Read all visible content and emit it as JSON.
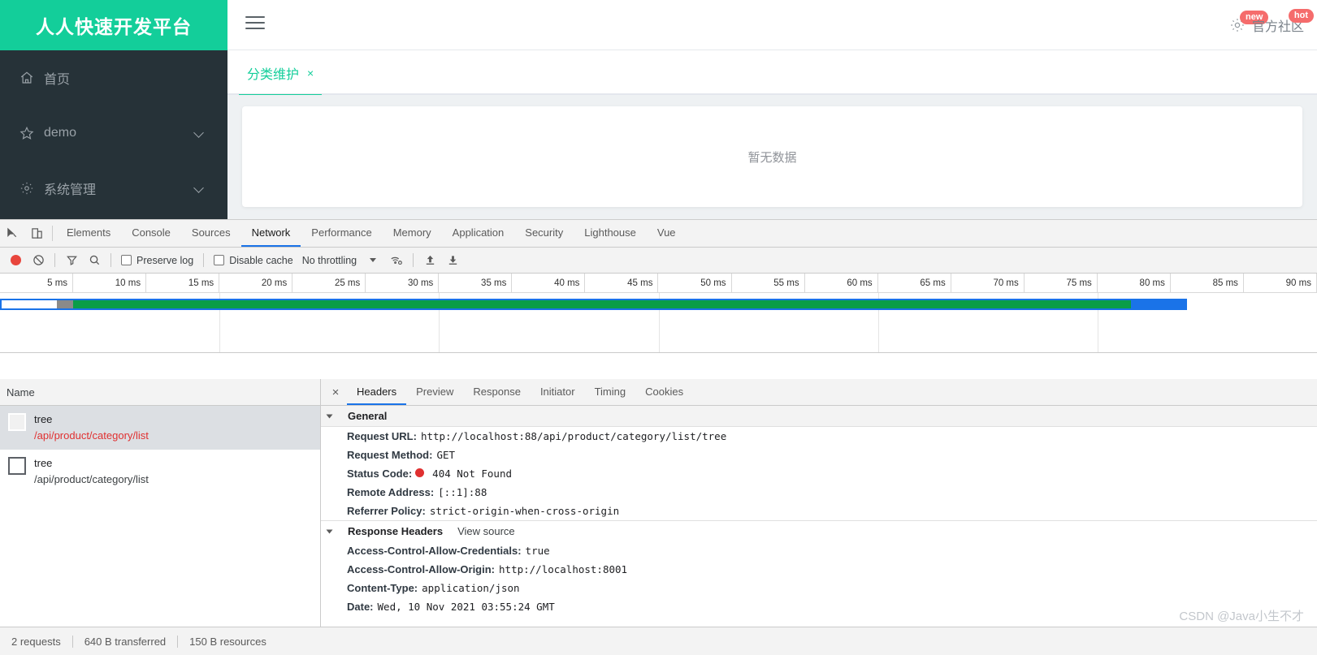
{
  "webapp": {
    "logo": "人人快速开发平台",
    "hamburger_icon": "hamburger-icon",
    "gear_icon": "gear-icon",
    "gear_badge": "new",
    "community_label": "官方社区",
    "community_badge": "hot",
    "sidebar": [
      {
        "label": "首页",
        "icon": "home-icon",
        "expandable": false
      },
      {
        "label": "demo",
        "icon": "star-icon",
        "expandable": true
      },
      {
        "label": "系统管理",
        "icon": "gear-icon",
        "expandable": true
      }
    ],
    "tabs": [
      {
        "label": "分类维护",
        "close": "×",
        "active": true
      }
    ],
    "card": {
      "empty_text": "暂无数据"
    }
  },
  "devtools": {
    "panel_tabs": [
      {
        "label": "Elements",
        "active": false
      },
      {
        "label": "Console",
        "active": false
      },
      {
        "label": "Sources",
        "active": false
      },
      {
        "label": "Network",
        "active": true
      },
      {
        "label": "Performance",
        "active": false
      },
      {
        "label": "Memory",
        "active": false
      },
      {
        "label": "Application",
        "active": false
      },
      {
        "label": "Security",
        "active": false
      },
      {
        "label": "Lighthouse",
        "active": false
      },
      {
        "label": "Vue",
        "active": false
      }
    ],
    "toolbar": {
      "record_icon": "record-icon",
      "clear_icon": "clear-icon",
      "filter_icon": "filter-icon",
      "search_icon": "search-icon",
      "preserve_log": {
        "label": "Preserve log",
        "checked": false
      },
      "disable_cache": {
        "label": "Disable cache",
        "checked": false
      },
      "throttling": "No throttling",
      "wifi_icon": "wifi-settings-icon",
      "import_icon": "upload-har-icon",
      "export_icon": "download-har-icon"
    },
    "timeline": {
      "ticks": [
        "5 ms",
        "10 ms",
        "15 ms",
        "20 ms",
        "25 ms",
        "30 ms",
        "35 ms",
        "40 ms",
        "45 ms",
        "50 ms",
        "55 ms",
        "60 ms",
        "65 ms",
        "70 ms",
        "75 ms",
        "80 ms",
        "85 ms",
        "90 ms"
      ],
      "unit": "ms",
      "bar_colors": {
        "blue": "#1a73e8",
        "green": "#0a9d48",
        "grey": "#8a8a8a"
      }
    },
    "requests": {
      "column_header": "Name",
      "rows": [
        {
          "name": "tree",
          "url": "/api/product/category/list",
          "error": true,
          "selected": true
        },
        {
          "name": "tree",
          "url": "/api/product/category/list",
          "error": false,
          "selected": false
        }
      ]
    },
    "detail_tabs": [
      {
        "label": "Headers",
        "active": true
      },
      {
        "label": "Preview",
        "active": false
      },
      {
        "label": "Response",
        "active": false
      },
      {
        "label": "Initiator",
        "active": false
      },
      {
        "label": "Timing",
        "active": false
      },
      {
        "label": "Cookies",
        "active": false
      }
    ],
    "close_icon": "×",
    "general": {
      "title": "General",
      "rows": [
        {
          "key": "Request URL:",
          "value": "http://localhost:88/api/product/category/list/tree"
        },
        {
          "key": "Request Method:",
          "value": "GET"
        },
        {
          "key": "Status Code:",
          "value": "404 Not Found",
          "status_dot": true
        },
        {
          "key": "Remote Address:",
          "value": "[::1]:88"
        },
        {
          "key": "Referrer Policy:",
          "value": "strict-origin-when-cross-origin"
        }
      ]
    },
    "response_headers": {
      "title": "Response Headers",
      "view_source": "View source",
      "rows": [
        {
          "key": "Access-Control-Allow-Credentials:",
          "value": "true"
        },
        {
          "key": "Access-Control-Allow-Origin:",
          "value": "http://localhost:8001"
        },
        {
          "key": "Content-Type:",
          "value": "application/json"
        },
        {
          "key": "Date:",
          "value": "Wed, 10 Nov 2021 03:55:24 GMT"
        }
      ]
    },
    "status_bar": {
      "requests": "2 requests",
      "transferred": "640 B transferred",
      "resources": "150 B resources"
    }
  },
  "watermark": "CSDN @Java小生不才"
}
